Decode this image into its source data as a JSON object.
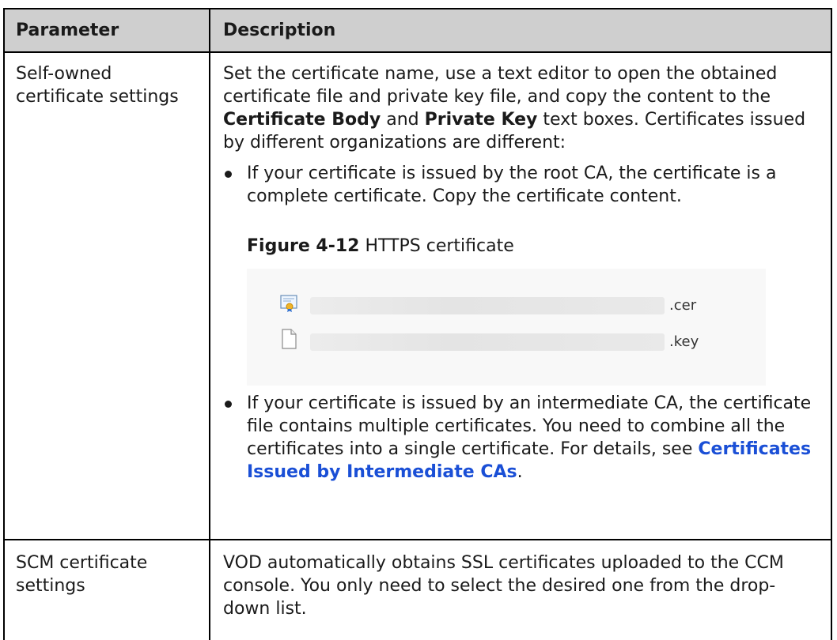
{
  "header": {
    "col1": "Parameter",
    "col2": "Description"
  },
  "row1": {
    "param": "Self-owned certificate settings",
    "intro_a": "Set the certificate name, use a text editor to open the obtained certificate file and private key file, and copy the content to the ",
    "intro_b": "Certificate Body",
    "intro_c": " and ",
    "intro_d": "Private Key",
    "intro_e": " text boxes. Certificates issued by different organizations are different:",
    "bullet1": "If your certificate is issued by the root CA, the certificate is a complete certificate. Copy the certificate content.",
    "figure_label": "Figure 4-12",
    "figure_title": " HTTPS certificate",
    "files": [
      {
        "ext": ".cer",
        "icon": "certificate-file-icon"
      },
      {
        "ext": ".key",
        "icon": "blank-file-icon"
      }
    ],
    "bullet2_a": "If your certificate is issued by an intermediate CA, the certificate file contains multiple certificates. You need to combine all the certificates into a single certificate. For details, see ",
    "bullet2_link": "Certificates Issued by Intermediate CAs",
    "bullet2_b": "."
  },
  "row2": {
    "param": "SCM certificate settings",
    "desc": "VOD automatically obtains SSL certificates uploaded to the CCM console. You only need to select the desired one from the drop-down list."
  },
  "colors": {
    "header_bg": "#cfcfcf",
    "link": "#1a4fd6"
  }
}
